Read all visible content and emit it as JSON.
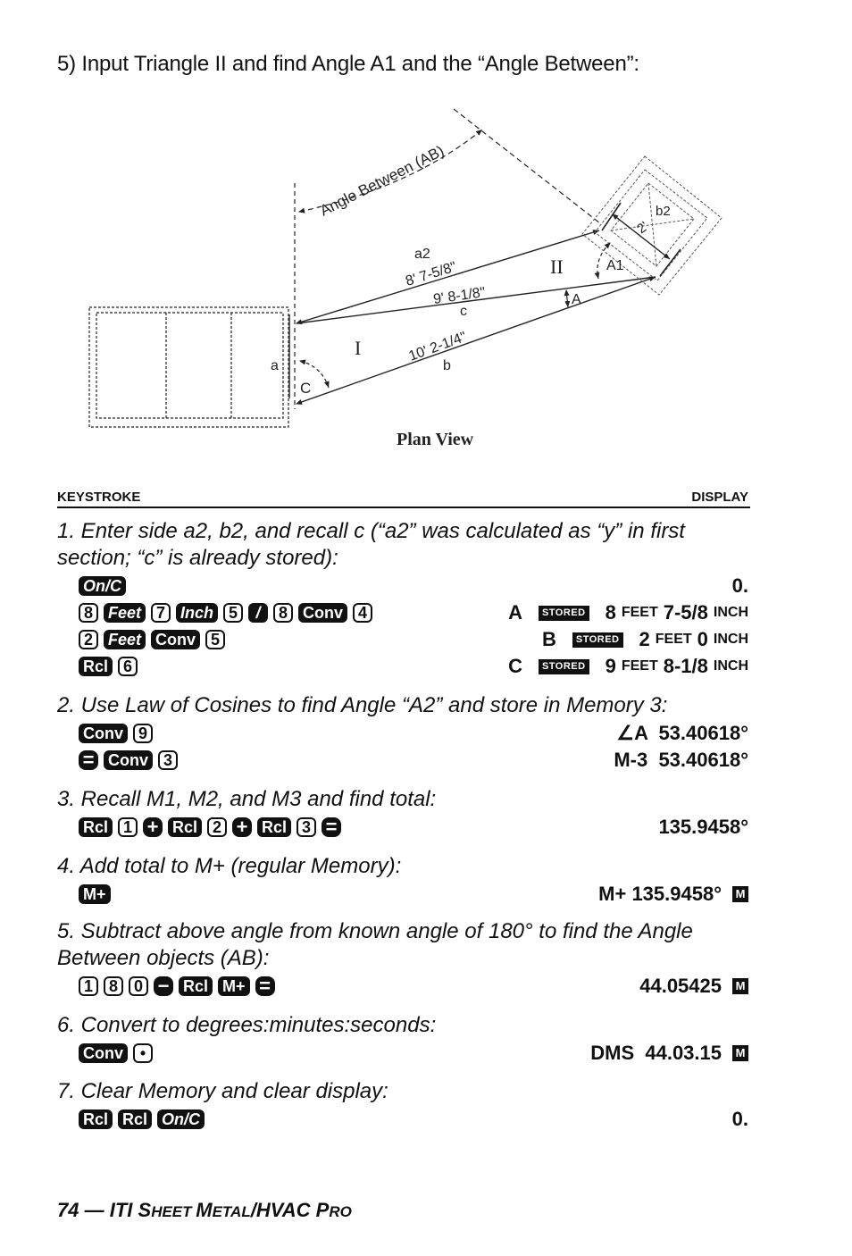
{
  "heading": "5) Input Triangle II and find Angle A1 and the “Angle Between”:",
  "diagram": {
    "angle_between_label": "Angle Between (AB)",
    "side_a2_label": "a2",
    "side_a2_value": "8' 7-5/8\"",
    "side_c_value": "9' 8-1/8\"",
    "side_c_label": "c",
    "side_b_value": "10' 2-1/4\"",
    "side_b_label": "b",
    "side_a_label": "a",
    "angle_c_label": "C",
    "angle_a_label": "A",
    "angle_a1_label": "A1",
    "side_b2_label": "b2",
    "b2_length": "2'",
    "triangle_1_label": "I",
    "triangle_2_label": "II",
    "caption": "Plan View"
  },
  "columns": {
    "keystroke": "KEYSTROKE",
    "display": "DISPLAY"
  },
  "steps": [
    {
      "text": "1. Enter side a2, b2, and recall c (“a2” was calculated as “y” in first section; “c” is already stored):",
      "rows": [
        {
          "keys": [
            "On/C"
          ],
          "display": "0."
        },
        {
          "keys": [
            "8",
            "Feet",
            "7",
            "Inch",
            "5",
            "/",
            "8",
            "Conv",
            "4"
          ],
          "display": {
            "prefix": "A",
            "badge": "STORED",
            "feet": "8",
            "feet_unit": "FEET",
            "inch": "7-5/8",
            "inch_unit": "INCH"
          }
        },
        {
          "keys": [
            "2",
            "Feet",
            "Conv",
            "5"
          ],
          "display": {
            "prefix": "B",
            "badge": "STORED",
            "feet": "2",
            "feet_unit": "FEET",
            "inch": "0",
            "inch_unit": "INCH"
          }
        },
        {
          "keys": [
            "Rcl",
            "6"
          ],
          "display": {
            "prefix": "C",
            "badge": "STORED",
            "feet": "9",
            "feet_unit": "FEET",
            "inch": "8-1/8",
            "inch_unit": "INCH"
          }
        }
      ]
    },
    {
      "text": "2. Use Law of Cosines to find Angle “A2” and store in Memory 3:",
      "rows": [
        {
          "keys": [
            "Conv",
            "9"
          ],
          "display": "∠A  53.40618°"
        },
        {
          "keys": [
            "=",
            "Conv",
            "3"
          ],
          "display": "M-3  53.40618°"
        }
      ]
    },
    {
      "text": "3. Recall M1, M2, and M3 and find total:",
      "rows": [
        {
          "keys": [
            "Rcl",
            "1",
            "+",
            "Rcl",
            "2",
            "+",
            "Rcl",
            "3",
            "="
          ],
          "display": "135.9458°"
        }
      ]
    },
    {
      "text": "4. Add total to M+ (regular Memory):",
      "rows": [
        {
          "keys": [
            "M+"
          ],
          "display": "M+ 135.9458°",
          "memory_flag": "M"
        }
      ]
    },
    {
      "text": "5. Subtract above angle from known angle of 180° to find the Angle Between objects (AB):",
      "rows": [
        {
          "keys": [
            "1",
            "8",
            "0",
            "−",
            "Rcl",
            "M+",
            "="
          ],
          "display": "44.05425",
          "memory_flag": "M"
        }
      ]
    },
    {
      "text": "6. Convert to degrees:minutes:seconds:",
      "rows": [
        {
          "keys": [
            "Conv",
            "•"
          ],
          "display": "DMS  44.03.15",
          "memory_flag": "M"
        }
      ]
    },
    {
      "text": "7. Clear Memory and clear display:",
      "rows": [
        {
          "keys": [
            "Rcl",
            "Rcl",
            "On/C"
          ],
          "display": "0."
        }
      ]
    }
  ],
  "footer": {
    "page": "74",
    "dash": " — ",
    "brand": "ITI ",
    "title_parts": [
      {
        "big": "S",
        "small": "HEET "
      },
      {
        "big": "M",
        "small": "ETAL"
      },
      {
        "big": "/HVAC ",
        "small": ""
      },
      {
        "big": "P",
        "small": "RO"
      }
    ]
  }
}
